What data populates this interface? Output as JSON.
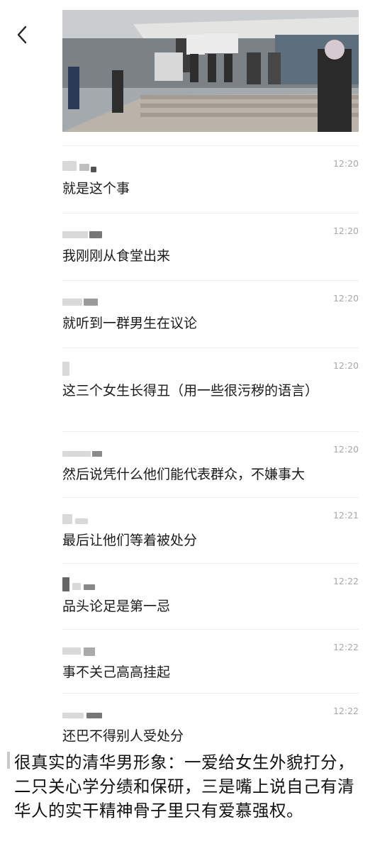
{
  "nav": {
    "back_icon": "chevron-left-icon"
  },
  "photo": {
    "description_icon": "photo"
  },
  "messages": [
    {
      "time": "12:20",
      "text": "就是这个事"
    },
    {
      "time": "12:20",
      "text": "我刚刚从食堂出来"
    },
    {
      "time": "12:20",
      "text": "就听到一群男生在议论"
    },
    {
      "time": "12:20",
      "text": "这三个女生长得丑（用一些很污秽的语言）"
    },
    {
      "time": "12:20",
      "text": "然后说凭什么他们能代表群众，不嫌事大"
    },
    {
      "time": "12:21",
      "text": "最后让他们等着被处分"
    },
    {
      "time": "12:22",
      "text": "品头论足是第一忌"
    },
    {
      "time": "12:22",
      "text": "事不关己高高挂起"
    },
    {
      "time": "12:22",
      "text": "还巴不得别人受处分"
    }
  ],
  "caption": {
    "text": "很真实的清华男形象：一爱给女生外貌打分，二只关心学分绩和保研，三是嘴上说自己有清华人的实干精神骨子里只有爱慕强权。"
  }
}
